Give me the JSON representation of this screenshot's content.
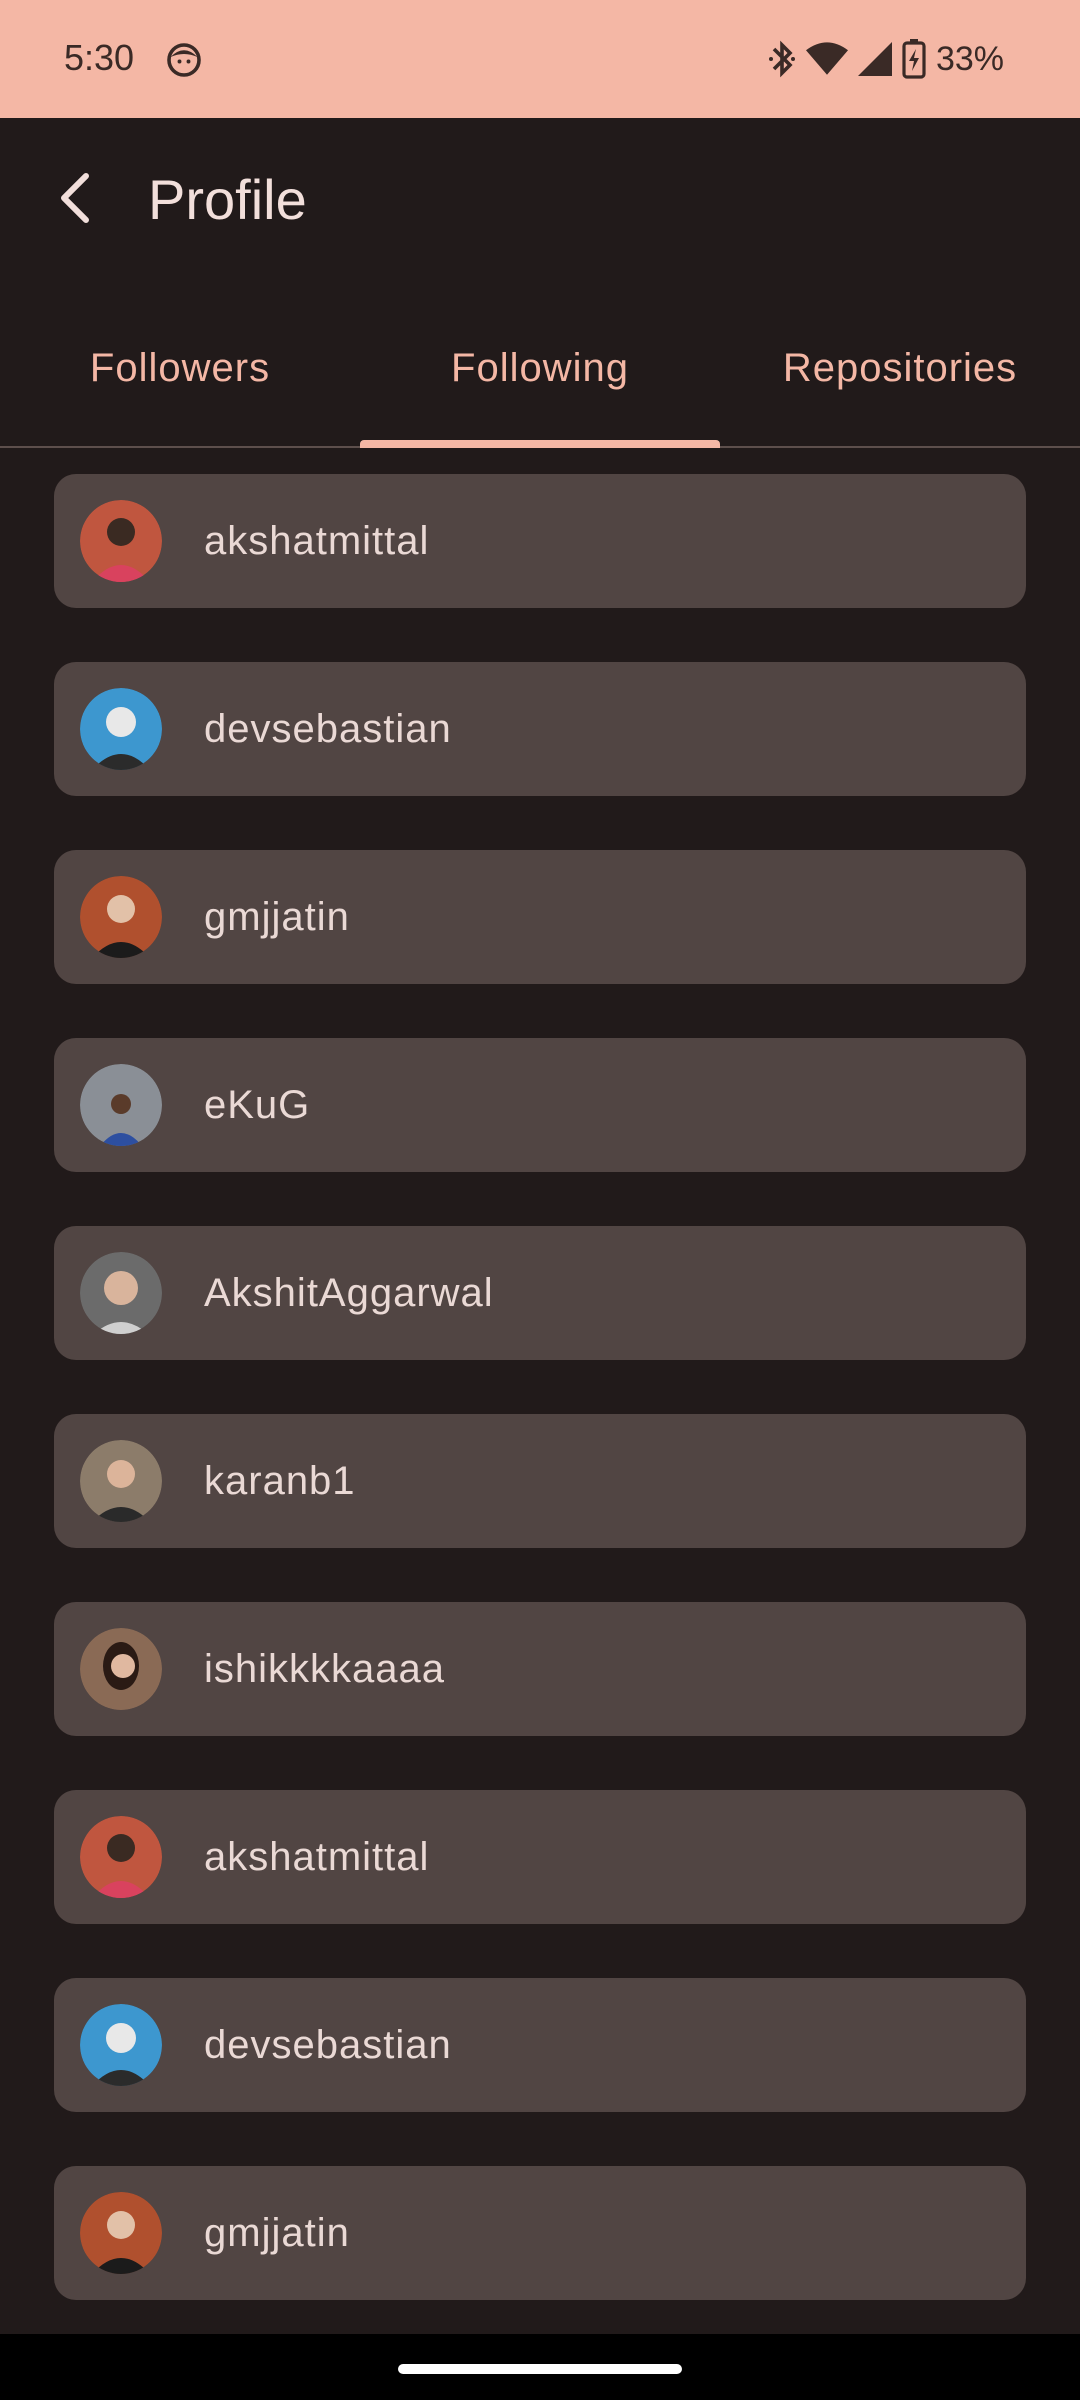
{
  "status_bar": {
    "time": "5:30",
    "battery_percent": "33%",
    "icons": [
      "face-icon",
      "bluetooth-icon",
      "wifi-icon",
      "signal-icon",
      "battery-charging-icon"
    ]
  },
  "app_bar": {
    "title": "Profile",
    "back_icon": "back-arrow-icon"
  },
  "tabs": [
    {
      "label": "Followers",
      "selected": false
    },
    {
      "label": "Following",
      "selected": true
    },
    {
      "label": "Repositories",
      "selected": false
    }
  ],
  "following": [
    {
      "username": "akshatmittal",
      "avatar_bg": "#c0563f"
    },
    {
      "username": "devsebastian",
      "avatar_bg": "#3d97cf"
    },
    {
      "username": "gmjjatin",
      "avatar_bg": "#b0502e"
    },
    {
      "username": "eKuG",
      "avatar_bg": "#8a8f96"
    },
    {
      "username": "AkshitAggarwal",
      "avatar_bg": "#6b6b6b"
    },
    {
      "username": "karanb1",
      "avatar_bg": "#8c7c6a"
    },
    {
      "username": "ishikkkkaaaa",
      "avatar_bg": "#8a6a55"
    },
    {
      "username": "akshatmittal",
      "avatar_bg": "#c0563f"
    },
    {
      "username": "devsebastian",
      "avatar_bg": "#3d97cf"
    },
    {
      "username": "gmjjatin",
      "avatar_bg": "#b0502e"
    }
  ],
  "colors": {
    "accent": "#f4b7a5",
    "background": "#211a1a",
    "card": "#514543",
    "text": "#ead9d5"
  }
}
